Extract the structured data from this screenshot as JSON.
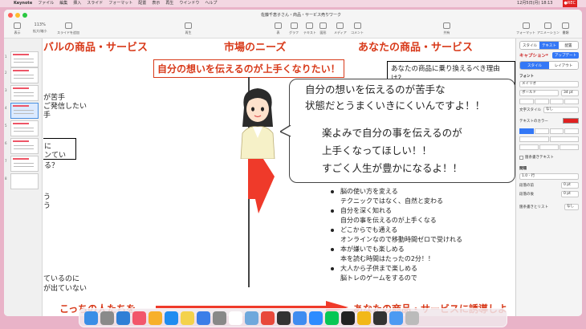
{
  "menubar": {
    "app_name": "Keynote",
    "items": [
      "ファイル",
      "編集",
      "挿入",
      "スライド",
      "フォーマット",
      "配置",
      "表示",
      "再生",
      "ウインドウ",
      "ヘルプ"
    ],
    "clock": "12月5日(月) 18:13",
    "rec_badge": "●REC"
  },
  "window": {
    "title": "佐藤千恵子さん・商品・サービス売りワーク",
    "toolbar": [
      {
        "label": "表示",
        "icon": "view-icon"
      },
      {
        "label": "拡大/縮小",
        "icon": "zoom-icon"
      },
      {
        "label": "スライドを追加",
        "icon": "add-slide-icon"
      },
      {
        "label": "再生",
        "icon": "play-icon"
      },
      {
        "label": "表",
        "icon": "table-icon"
      },
      {
        "label": "グラフ",
        "icon": "chart-icon"
      },
      {
        "label": "テキスト",
        "icon": "text-icon"
      },
      {
        "label": "図形",
        "icon": "shape-icon"
      },
      {
        "label": "メディア",
        "icon": "media-icon"
      },
      {
        "label": "コメント",
        "icon": "comment-icon"
      },
      {
        "label": "共有",
        "icon": "share-icon"
      },
      {
        "label": "フォーマット",
        "icon": "format-icon"
      },
      {
        "label": "アニメーション",
        "icon": "animate-icon"
      },
      {
        "label": "書類",
        "icon": "document-icon"
      }
    ],
    "zoom": "113%"
  },
  "navigator": {
    "slides": [
      "1",
      "2",
      "3",
      "4",
      "5",
      "6",
      "7",
      "8"
    ],
    "active_index": 3
  },
  "slide": {
    "col_left_head": "バルの商品・サービス",
    "col_mid_head": "市場のニーズ",
    "col_right_head": "あなたの商品・サービス",
    "needs_box": "自分の想いを伝えるのが上手くなりたい！",
    "switch_question": "あなたの商品に乗り換えるべき理由は？",
    "left_fragments": [
      "が苦手",
      "ご発信したい",
      "手"
    ],
    "left_box_line1": "に",
    "left_box_line2": "ンている？",
    "left_small": "う",
    "left_bottom1": "ているのに",
    "left_bottom2": "が出ていない",
    "bubble_line1": "自分の想いを伝えるのが苦手な",
    "bubble_line2": "状態だとうまくいきにくいんですよ！！",
    "bubble_line3": "楽よみで自分の事を伝えるのが",
    "bubble_line4": "上手くなってほしい！！",
    "bubble_line5": "すごく人生が豊かになるよ！！",
    "bullets": [
      {
        "main": "脳の使い方を変える",
        "sub": "テクニックではなく、自然と変わる"
      },
      {
        "main": "自分を深く知れる",
        "sub": "自分の事を伝えるのが上手くなる"
      },
      {
        "main": "どこからでも通える",
        "sub": "オンラインなので移動時間ゼロで受けれる"
      },
      {
        "main": "本が嫌いでも楽しめる",
        "sub": "本を読む時間はたったの2分！！"
      },
      {
        "main": "大人から子供まで楽しめる",
        "sub": "脳トレのゲームをするので"
      }
    ],
    "bottom_left": "こっちの人たちを",
    "bottom_right": "あなたの商品・サービスに誘導しよ"
  },
  "inspector": {
    "tabs": [
      "スタイル",
      "テキスト",
      "配置"
    ],
    "active_tab": "テキスト",
    "paragraph_style": "キャプション*",
    "update_button": "アップデート",
    "subtabs": [
      "スタイル",
      "レイアウト"
    ],
    "font_label": "フォント",
    "font_name": "メイリオ",
    "font_weight": "ボールド",
    "font_size": "34 pt",
    "char_style_label": "文字スタイル",
    "char_style_value": "なし",
    "text_color_label": "テキストのカラー",
    "text_color": "#e02020",
    "indent_label": "箇条書きテキスト",
    "spacing_label": "間隔",
    "spacing_value": "1.0 - 行",
    "before_label": "段落の前",
    "before_value": "0 pt",
    "after_label": "段落の後",
    "after_value": "0 pt",
    "bullets_label": "箇条書きとリスト",
    "bullets_value": "なし"
  },
  "dock": {
    "apps": [
      "finder-icon",
      "launchpad-icon",
      "safari-icon",
      "music-icon",
      "photos-icon",
      "appstore-icon",
      "notes-icon",
      "mail-icon",
      "settings-icon",
      "calendar-icon",
      "preview-icon",
      "chrome-icon",
      "finalcut-icon",
      "keynote-icon",
      "zoom-icon",
      "line-icon",
      "kindle-icon",
      "drive-icon",
      "terminal-icon",
      "files-icon",
      "trash-icon"
    ],
    "colors": [
      "#3a8ee6",
      "#8a8a8a",
      "#2f7fd6",
      "#f2566b",
      "#f7b02a",
      "#1f8cf0",
      "#f4d24b",
      "#3b7ee8",
      "#888888",
      "#ffffff",
      "#6fa8dc",
      "#e8483b",
      "#333333",
      "#3f8cf0",
      "#2d8cff",
      "#06c755",
      "#222222",
      "#f2b818",
      "#333333",
      "#4c9af2",
      "#bbbbbb"
    ]
  }
}
